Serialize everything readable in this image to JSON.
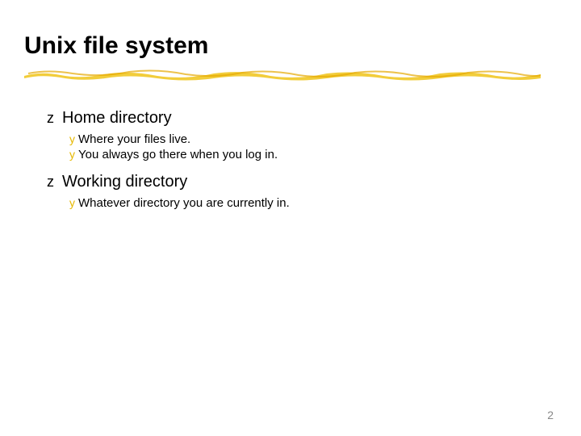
{
  "title": "Unix file system",
  "bullets": {
    "z": "z",
    "y": "y"
  },
  "items": [
    {
      "heading": "Home directory",
      "subs": [
        "Where your files live.",
        "You always go there when you log in."
      ]
    },
    {
      "heading": "Working directory",
      "subs": [
        "Whatever directory you are currently in."
      ]
    }
  ],
  "page_number": "2"
}
